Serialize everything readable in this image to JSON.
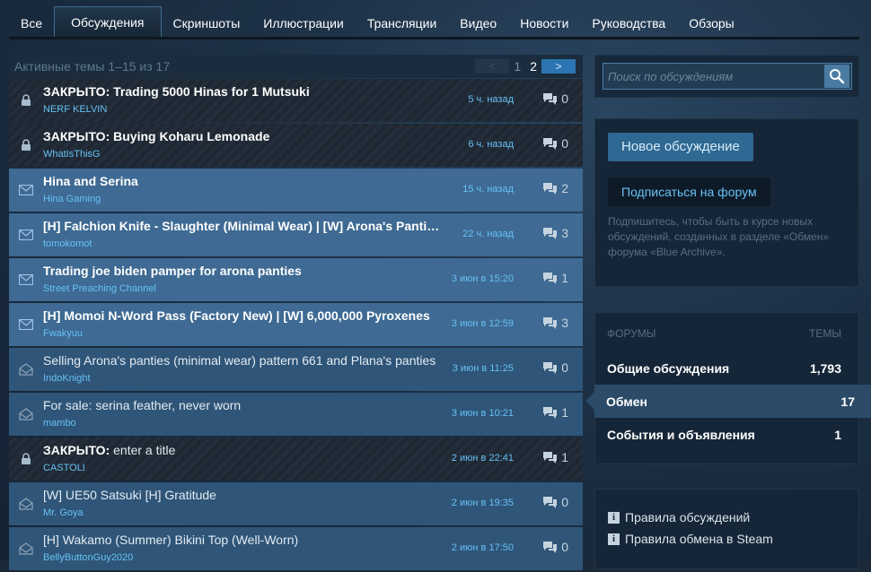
{
  "tabs": [
    "Все",
    "Обсуждения",
    "Скриншоты",
    "Иллюстрации",
    "Трансляции",
    "Видео",
    "Новости",
    "Руководства",
    "Обзоры"
  ],
  "active_tab": "Обсуждения",
  "list_header": {
    "count_text": "Активные темы 1–15 из 17",
    "prev_label": "<",
    "next_label": ">",
    "pages": [
      "1",
      "2"
    ],
    "current_page": "2"
  },
  "topics": [
    {
      "state": "locked",
      "lock_prefix": "ЗАКРЫТО:",
      "title": " Trading 5000 Hinas for 1 Mutsuki",
      "bold": true,
      "author": "NERF KELVIN",
      "time": "5 ч. назад",
      "replies": "0"
    },
    {
      "state": "locked",
      "lock_prefix": "ЗАКРЫТО:",
      "title": " Buying Koharu Lemonade",
      "bold": true,
      "author": "WhatIsThisG",
      "time": "6 ч. назад",
      "replies": "0"
    },
    {
      "state": "unread",
      "lock_prefix": "",
      "title": "Hina and Serina",
      "bold": true,
      "author": "Hina Gaming",
      "time": "15 ч. назад",
      "replies": "2"
    },
    {
      "state": "unread",
      "lock_prefix": "",
      "title": "[H] Falchion Knife - Slaughter (Minimal Wear) | [W] Arona's Panties (Factory New)",
      "bold": true,
      "author": "tomokomot",
      "time": "22 ч. назад",
      "replies": "3"
    },
    {
      "state": "unread",
      "lock_prefix": "",
      "title": "Trading joe biden pamper for arona panties",
      "bold": true,
      "author": "Street Preaching Channel",
      "time": "3 июн в 15:20",
      "replies": "1"
    },
    {
      "state": "unread",
      "lock_prefix": "",
      "title": "[H] Momoi N-Word Pass (Factory New) | [W] 6,000,000 Pyroxenes",
      "bold": true,
      "author": "Fwakyuu",
      "time": "3 июн в 12:59",
      "replies": "3"
    },
    {
      "state": "read",
      "lock_prefix": "",
      "title": "Selling Arona's panties (minimal wear) pattern 661 and Plana's panties",
      "bold": false,
      "author": "IndoKnight",
      "time": "3 июн в 11:25",
      "replies": "0"
    },
    {
      "state": "read",
      "lock_prefix": "",
      "title": "For sale: serina feather, never worn",
      "bold": false,
      "author": "mambo",
      "time": "3 июн в 10:21",
      "replies": "1"
    },
    {
      "state": "locked",
      "lock_prefix": "ЗАКРЫТО:",
      "title": " enter a title",
      "bold": false,
      "author": "CASTOLI",
      "time": "2 июн в 22:41",
      "replies": "1"
    },
    {
      "state": "read",
      "lock_prefix": "",
      "title": "[W] UE50 Satsuki [H] Gratitude",
      "bold": false,
      "author": "Mr. Goya",
      "time": "2 июн в 19:35",
      "replies": "0"
    },
    {
      "state": "read",
      "lock_prefix": "",
      "title": "[H] Wakamo (Summer) Bikini Top (Well-Worn)",
      "bold": false,
      "author": "BellyButtonGuy2020",
      "time": "2 июн в 17:50",
      "replies": "0"
    }
  ],
  "search": {
    "placeholder": "Поиск по обсуждениям"
  },
  "actions": {
    "new_topic": "Новое обсуждение",
    "subscribe": "Подписаться на форум",
    "subscribe_note": "Подпишитесь, чтобы быть в курсе новых обсуждений, созданных в разделе «Обмен» форума «Blue Archive»."
  },
  "forums": {
    "head_left": "ФОРУМЫ",
    "head_right": "ТЕМЫ",
    "items": [
      {
        "name": "Общие обсуждения",
        "count": "1,793",
        "active": false
      },
      {
        "name": "Обмен",
        "count": "17",
        "active": true
      },
      {
        "name": "События и объявления",
        "count": "1",
        "active": false
      }
    ]
  },
  "rules": [
    "Правила обсуждений",
    "Правила обмена в Steam"
  ],
  "colors": {
    "accent": "#67c1f5",
    "bg": "#1b2838",
    "unread": "#3e6a93",
    "read": "#2f5578"
  }
}
